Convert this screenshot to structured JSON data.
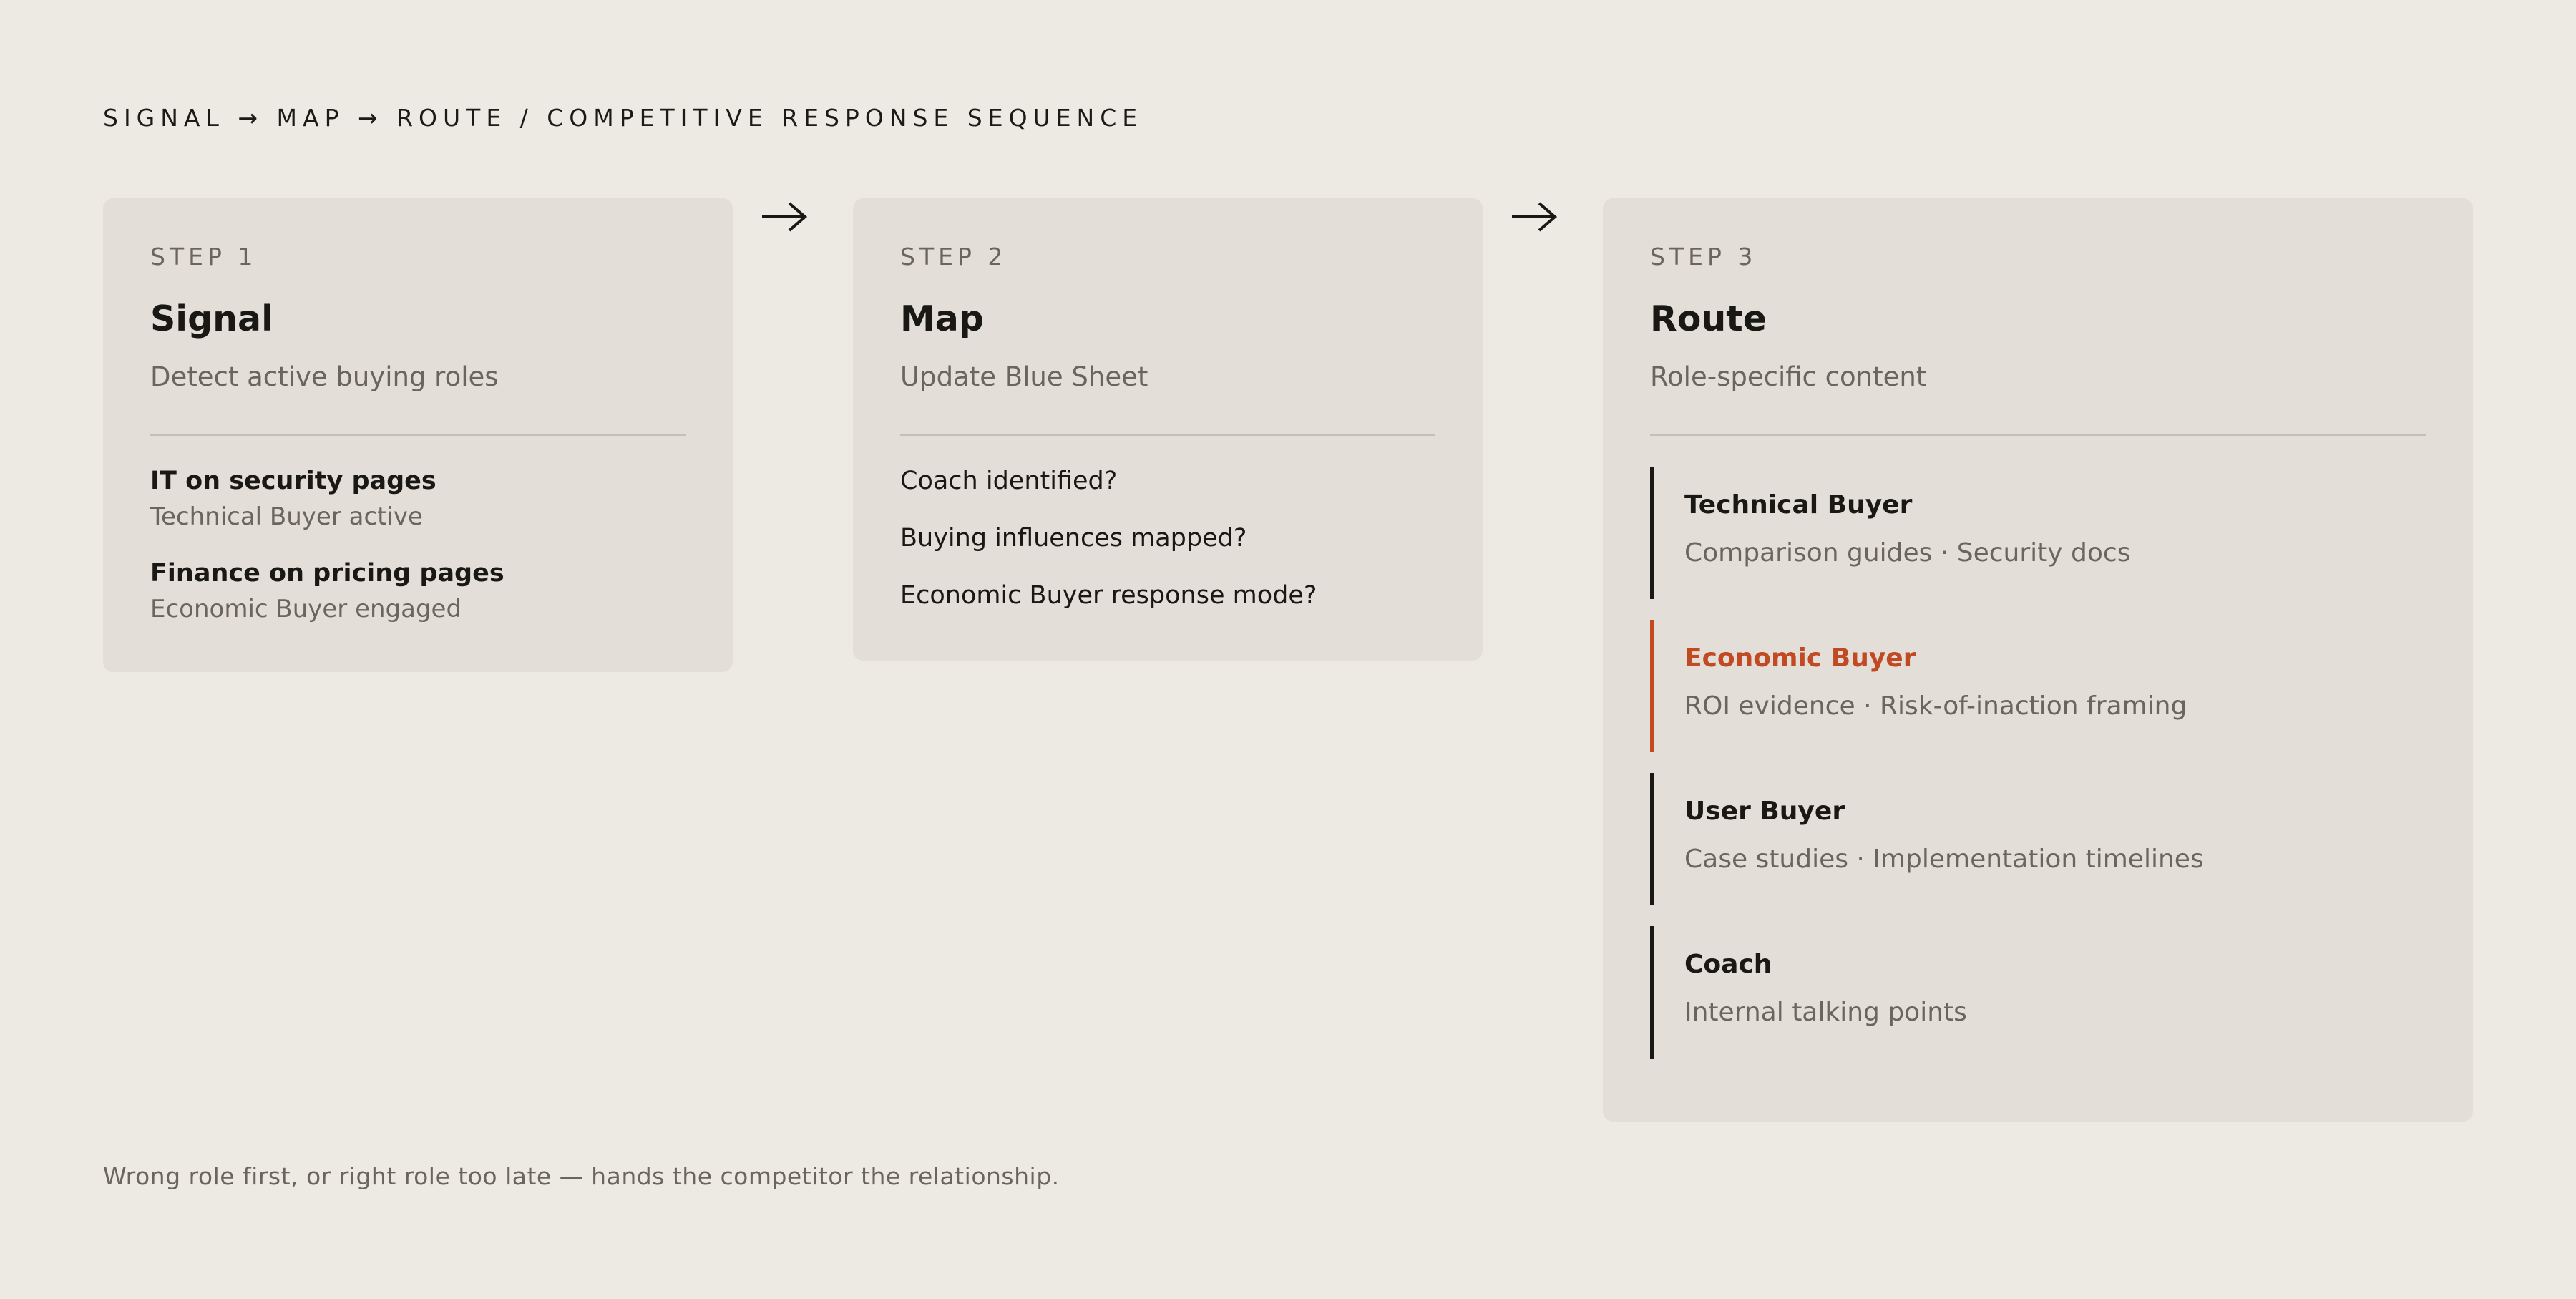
{
  "header": {
    "title": "SIGNAL → MAP → ROUTE  /  COMPETITIVE RESPONSE SEQUENCE"
  },
  "colors": {
    "background": "#edeae3",
    "card": "#e3dfd8",
    "text": "#1a1814",
    "muted": "#6a655d",
    "accent": "#c14a23",
    "divider": "#c5c0b7"
  },
  "steps": [
    {
      "label": "STEP 1",
      "title": "Signal",
      "subtitle": "Detect active buying roles",
      "signals": [
        {
          "title": "IT on security pages",
          "desc": "Technical Buyer active"
        },
        {
          "title": "Finance on pricing pages",
          "desc": "Economic Buyer engaged"
        }
      ]
    },
    {
      "label": "STEP 2",
      "title": "Map",
      "subtitle": "Update Blue Sheet",
      "questions": [
        "Coach identified?",
        "Buying influences mapped?",
        "Economic Buyer response mode?"
      ]
    },
    {
      "label": "STEP 3",
      "title": "Route",
      "subtitle": "Role-specific content",
      "roles": [
        {
          "title": "Technical Buyer",
          "desc": "Comparison guides · Security docs",
          "highlight": false
        },
        {
          "title": "Economic Buyer",
          "desc": "ROI evidence · Risk-of-inaction framing",
          "highlight": true
        },
        {
          "title": "User Buyer",
          "desc": "Case studies · Implementation timelines",
          "highlight": false
        },
        {
          "title": "Coach",
          "desc": "Internal talking points",
          "highlight": false
        }
      ]
    }
  ],
  "arrows": [
    {
      "icon": "arrow-right-icon"
    },
    {
      "icon": "arrow-right-icon"
    }
  ],
  "footnote": "Wrong role first, or right role too late — hands the competitor the relationship."
}
